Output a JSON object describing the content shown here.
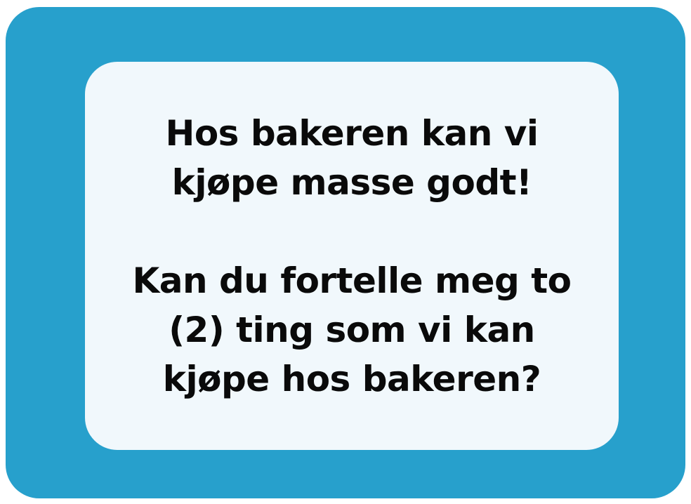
{
  "colors": {
    "frame": "#27a0cc",
    "panel": "#f1f8fc",
    "text": "#0a0a0a"
  },
  "card": {
    "intro_lines": [
      "Hos bakeren kan vi",
      "kjøpe masse godt!"
    ],
    "question_lines": [
      "Kan du fortelle meg to",
      "(2) ting som vi kan",
      "kjøpe hos bakeren?"
    ]
  }
}
